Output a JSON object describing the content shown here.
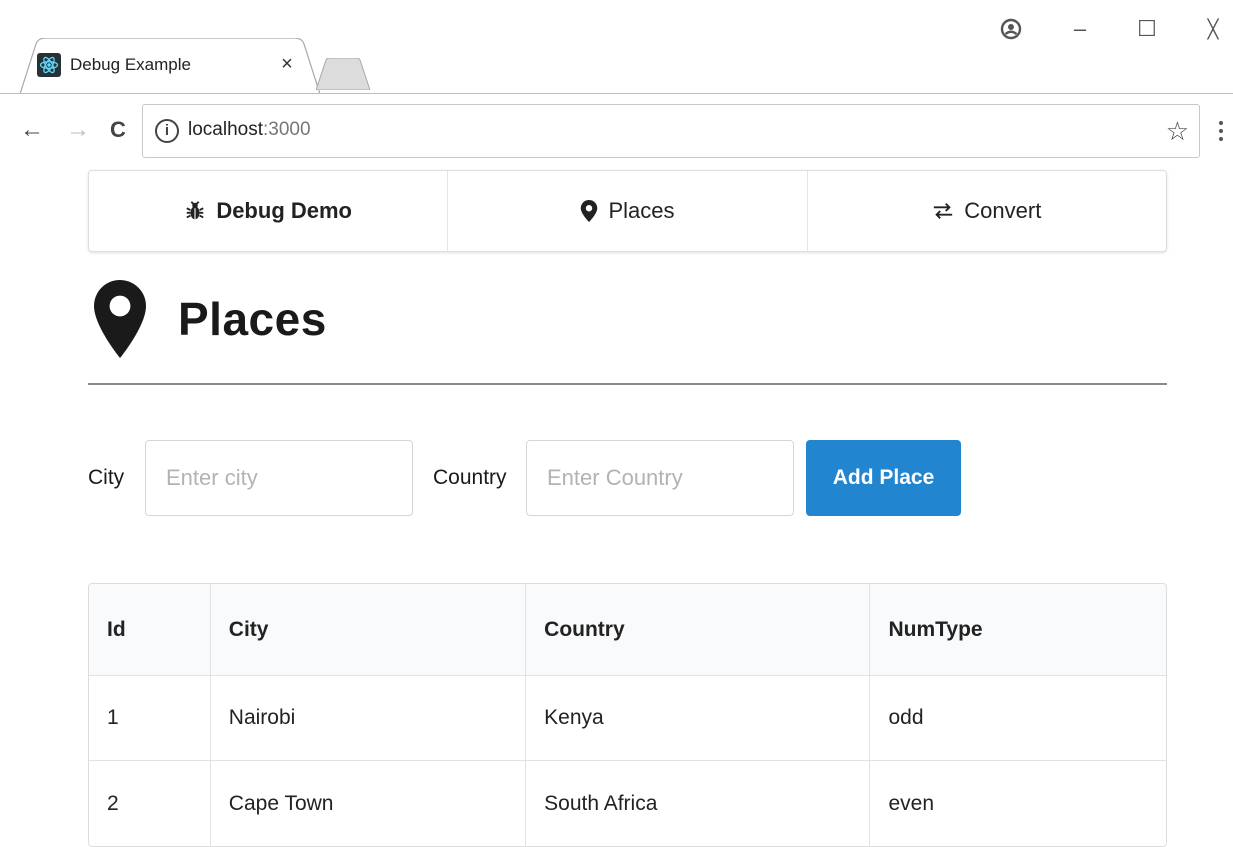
{
  "browser": {
    "tab_title": "Debug Example",
    "tab_close": "×",
    "url_host": "localhost",
    "url_port": ":3000",
    "info_glyph": "i",
    "star_glyph": "☆",
    "back_glyph": "←",
    "forward_glyph": "→",
    "reload_glyph": "C",
    "minimize_glyph": "–",
    "maximize_glyph": "☐",
    "close_glyph": "╳"
  },
  "navbar": {
    "items": [
      {
        "label": "Debug Demo",
        "icon": "bug-icon"
      },
      {
        "label": "Places",
        "icon": "map-pin-icon"
      },
      {
        "label": "Convert",
        "icon": "exchange-icon"
      }
    ]
  },
  "page": {
    "title": "Places",
    "title_icon": "map-pin-icon"
  },
  "form": {
    "city_label": "City",
    "city_placeholder": "Enter city",
    "city_value": "",
    "country_label": "Country",
    "country_placeholder": "Enter Country",
    "country_value": "",
    "submit_label": "Add Place",
    "accent_color": "#2185d0"
  },
  "table": {
    "headers": [
      "Id",
      "City",
      "Country",
      "NumType"
    ],
    "rows": [
      [
        "1",
        "Nairobi",
        "Kenya",
        "odd"
      ],
      [
        "2",
        "Cape Town",
        "South Africa",
        "even"
      ]
    ]
  }
}
